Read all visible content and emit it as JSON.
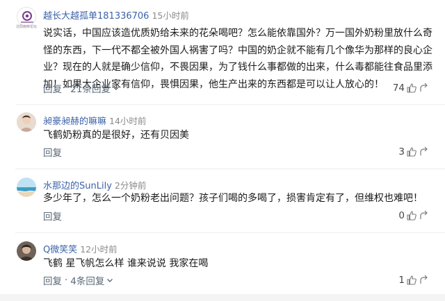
{
  "comments": [
    {
      "username": "越长大越孤单181336706",
      "time": "15小时前",
      "avatar": "logo-avatar",
      "avatar_caption": "沈阳雨林论坛",
      "text": "说实话，中国应该造优质奶给未来的花朵喝吧？怎么能依靠国外？万一国外奶粉里放什么奇怪的东西，下一代不都全被外国人祸害了吗？中国的奶企就不能有几个像华为那样的良心企业？现在的人就是确少信仰，不畏因果，为了钱什么事都做的出来，什么毒都能往食品里添加！如果大企业家有信仰，畏惧因果，他生产出来的东西都是可以让人放心的！",
      "reply_label": "回复",
      "reply_count_label": "21条回复",
      "likes": "74"
    },
    {
      "username": "昶豪昶赫的嘛嘛",
      "time": "14小时前",
      "avatar": "child-photo-avatar",
      "text": "飞鹤奶粉真的是很好，还有贝因美",
      "reply_label": "回复",
      "likes": "3"
    },
    {
      "username": "水那边的SunLily",
      "time": "2分钟前",
      "avatar": "sea-photo-avatar",
      "text": "多少年了，怎么一个奶粉老出问题？孩子们喝的多喝了，损害肯定有了，但维权也难吧！",
      "reply_label": "回复",
      "likes": "0"
    },
    {
      "username": "Q微笑笑",
      "time": "12小时前",
      "avatar": "portrait-photo-avatar",
      "text": "飞鹤 星飞帆怎么样 谁来说说 我家在喝",
      "reply_label": "回复",
      "reply_count_label": "4条回复",
      "likes": "1"
    }
  ],
  "colors": {
    "username": "#3b63a8",
    "time": "#8a8a8a",
    "action": "#5a6878"
  },
  "icons": {
    "like": "thumbs-up-icon",
    "reply": "reply-arrow-icon",
    "expand": "chevron-down-icon"
  }
}
